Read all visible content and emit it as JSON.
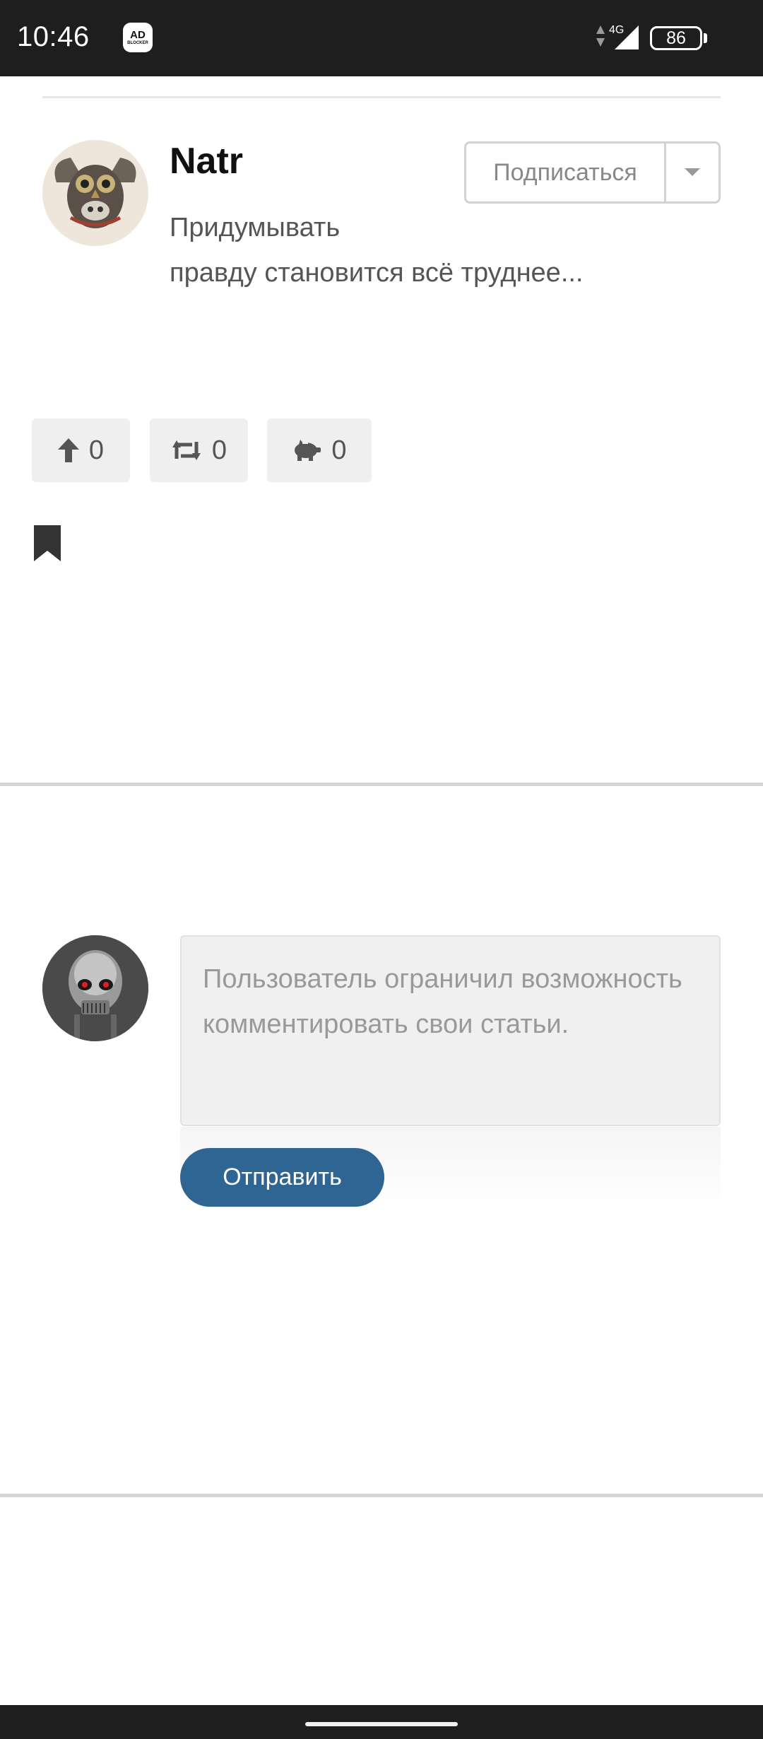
{
  "status_bar": {
    "time": "10:46",
    "adblock_top": "AD",
    "adblock_bottom": "BLOCKER",
    "network": "4G",
    "battery": "86"
  },
  "author": {
    "name": "Natr",
    "bio_line1": "Придумывать",
    "bio_line2": "правду становится всё труднее..."
  },
  "subscribe": {
    "label": "Подписаться"
  },
  "reactions": {
    "upvotes": "0",
    "reposts": "0",
    "donations": "0"
  },
  "comment": {
    "placeholder": "Пользователь ограничил возможность комментировать свои статьи.",
    "send_label": "Отправить"
  },
  "colors": {
    "accent": "#2f6592",
    "status_bar": "#1e1e1e",
    "reaction_bg": "#efefef"
  },
  "icons": {
    "upvote": "arrow-up-icon",
    "repost": "repost-icon",
    "donate": "piggy-bank-icon",
    "bookmark": "bookmark-icon",
    "dropdown": "chevron-down-icon"
  }
}
